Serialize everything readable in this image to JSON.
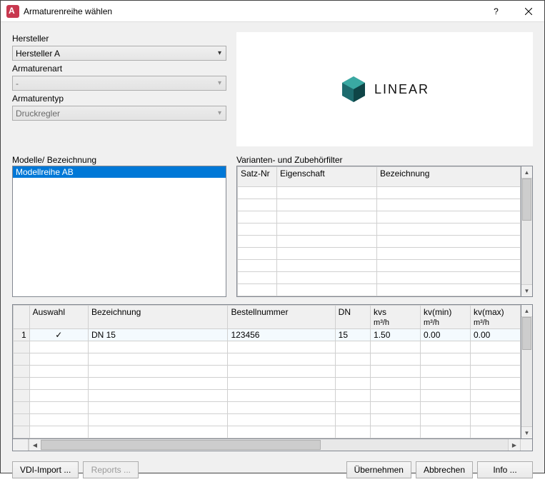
{
  "window": {
    "title": "Armaturenreihe wählen"
  },
  "form": {
    "hersteller_label": "Hersteller",
    "hersteller_value": "Hersteller A",
    "armaturenart_label": "Armaturenart",
    "armaturenart_value": "-",
    "armaturentyp_label": "Armaturentyp",
    "armaturentyp_value": "Druckregler",
    "modelle_label": "Modelle/ Bezeichnung",
    "modelle_items": [
      "Modellreihe AB"
    ],
    "varianten_label": "Varianten- und Zubehörfilter"
  },
  "logo": {
    "text": "LINEAR"
  },
  "filter_table": {
    "headers": {
      "satznr": "Satz-Nr",
      "eigenschaft": "Eigenschaft",
      "bezeichnung": "Bezeichnung"
    },
    "empty_rows": 9
  },
  "main_table": {
    "headers": {
      "auswahl": "Auswahl",
      "bezeichnung": "Bezeichnung",
      "bestellnummer": "Bestellnummer",
      "dn": "DN",
      "kvs": "kvs",
      "kvmin": "kv(min)",
      "kvmax": "kv(max)",
      "unit": "m³/h"
    },
    "rows": [
      {
        "num": "1",
        "auswahl": "✓",
        "bezeichnung": "DN 15",
        "bestellnummer": "123456",
        "dn": "15",
        "kvs": "1.50",
        "kvmin": "0.00",
        "kvmax": "0.00"
      }
    ],
    "empty_rows": 8
  },
  "buttons": {
    "vdi": "VDI-Import ...",
    "reports": "Reports ...",
    "uebernehmen": "Übernehmen",
    "abbrechen": "Abbrechen",
    "info": "Info ..."
  }
}
